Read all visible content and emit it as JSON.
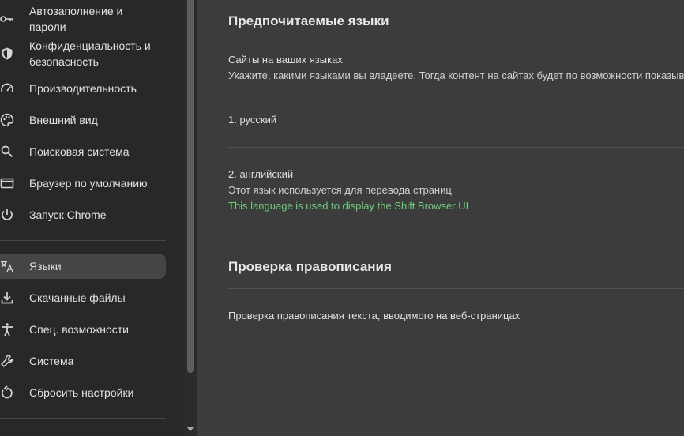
{
  "sidebar": {
    "items": [
      {
        "label": "Автозаполнение и пароли"
      },
      {
        "label": "Конфиденциальность и безопасность"
      },
      {
        "label": "Производительность"
      },
      {
        "label": "Внешний вид"
      },
      {
        "label": "Поисковая система"
      },
      {
        "label": "Браузер по умолчанию"
      },
      {
        "label": "Запуск Chrome"
      },
      {
        "label": "Языки"
      },
      {
        "label": "Скачанные файлы"
      },
      {
        "label": "Спец. возможности"
      },
      {
        "label": "Система"
      },
      {
        "label": "Сбросить настройки"
      }
    ]
  },
  "languages": {
    "heading": "Предпочитаемые языки",
    "sites_title": "Сайты на ваших языках",
    "sites_description": "Укажите, какими языками вы владеете. Тогда контент на сайтах будет по возможности показыва",
    "lang1": "1. русский",
    "lang2": "2. английский",
    "lang2_note": "Этот язык используется для перевода страниц",
    "lang2_ui_note": "This language is used to display the Shift Browser UI"
  },
  "spellcheck": {
    "heading": "Проверка правописания",
    "description": "Проверка правописания текста, вводимого на веб-страницах"
  },
  "colors": {
    "accent_green": "#6fcf7a",
    "active_bg": "#454545"
  }
}
